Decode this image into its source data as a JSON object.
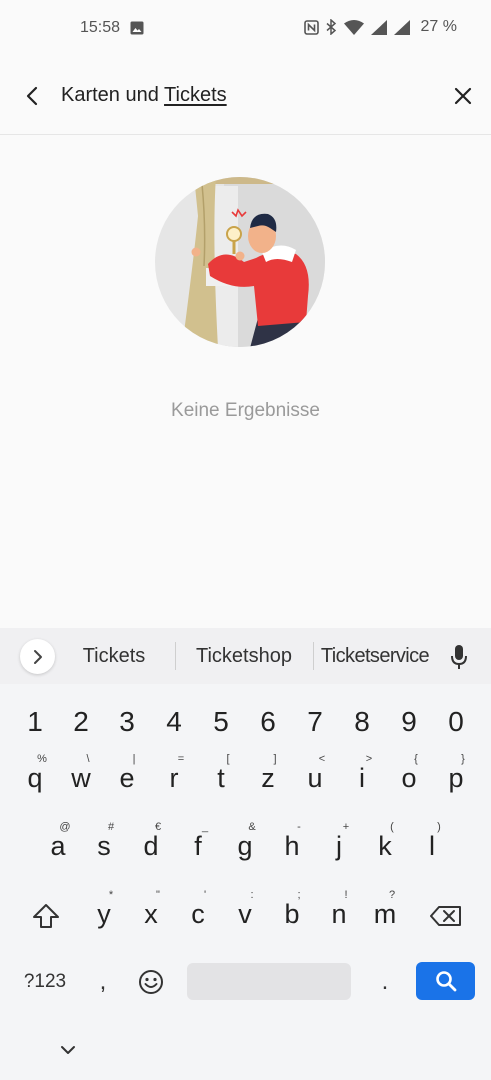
{
  "status_bar": {
    "time": "15:58",
    "battery": "27 %",
    "icons": [
      "gallery-icon",
      "nfc-icon",
      "bluetooth-icon",
      "wifi-icon",
      "signal-icon",
      "signal-icon"
    ]
  },
  "toolbar": {
    "title_prefix": "Karten und ",
    "title_highlight": "Tickets",
    "back_icon": "chevron-left-icon",
    "close_icon": "close-icon"
  },
  "empty_state": {
    "illustration": "person-peeking-behind-curtain",
    "message": "Keine Ergebnisse"
  },
  "suggestions": {
    "items": [
      "Tickets",
      "Ticketshop",
      "Ticketservice"
    ],
    "expand_icon": "chevron-right-icon",
    "mic_icon": "microphone-icon"
  },
  "keyboard": {
    "numbers": [
      "1",
      "2",
      "3",
      "4",
      "5",
      "6",
      "7",
      "8",
      "9",
      "0"
    ],
    "row1": {
      "keys": [
        "q",
        "w",
        "e",
        "r",
        "t",
        "z",
        "u",
        "i",
        "o",
        "p"
      ],
      "hints": [
        "%",
        "\\",
        "|",
        "=",
        "[",
        "]",
        "<",
        ">",
        "{",
        "}"
      ]
    },
    "row2": {
      "keys": [
        "a",
        "s",
        "d",
        "f",
        "g",
        "h",
        "j",
        "k",
        "l"
      ],
      "hints": [
        "@",
        "#",
        "€",
        "_",
        "&",
        "-",
        "+",
        "(",
        ")"
      ]
    },
    "row3": {
      "keys": [
        "y",
        "x",
        "c",
        "v",
        "b",
        "n",
        "m"
      ],
      "hints": [
        "*",
        "\"",
        "'",
        ":",
        ";",
        "!",
        "?"
      ]
    },
    "symbols_label": "?123",
    "comma": ",",
    "period": ".",
    "accent_color": "#1a73e8"
  }
}
